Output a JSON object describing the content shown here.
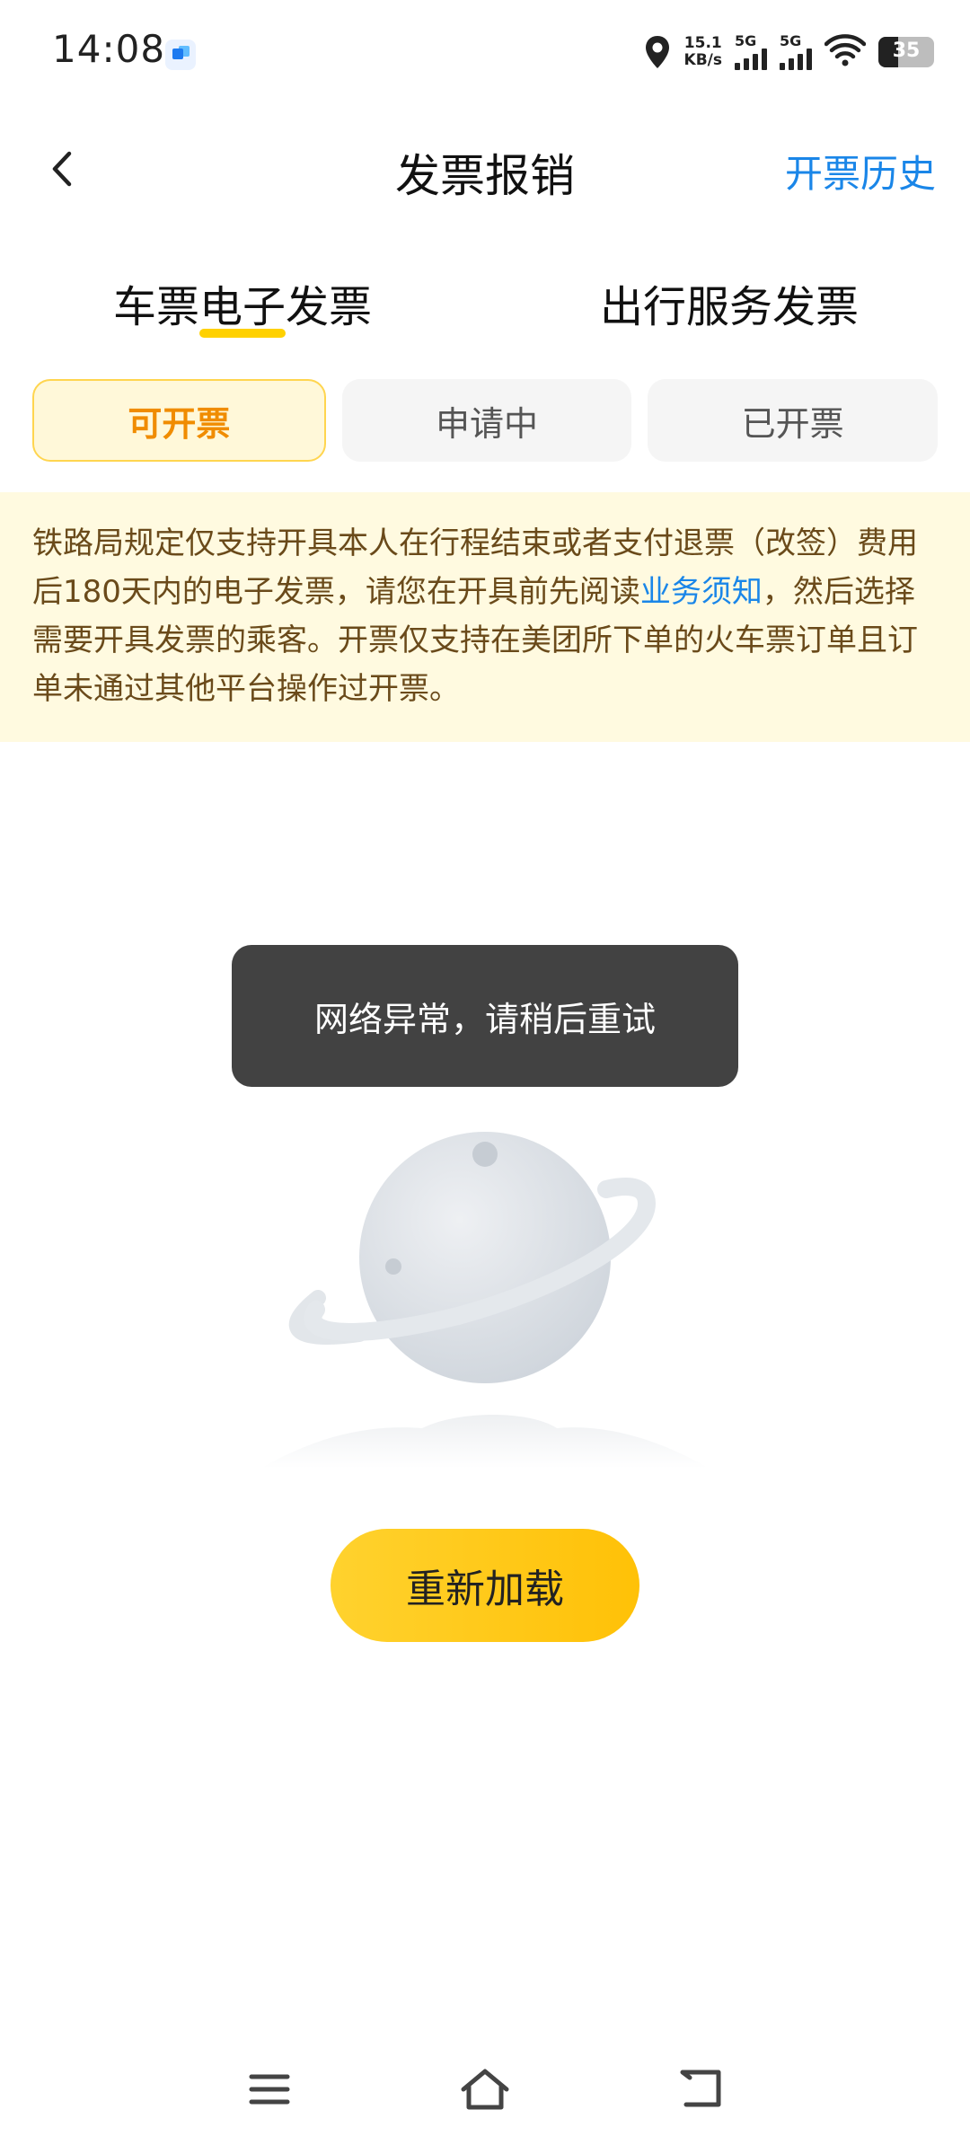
{
  "status_bar": {
    "time": "14:08",
    "net_speed_value": "15.1",
    "net_speed_unit": "KB/s",
    "sim1_label": "5G",
    "sim2_label": "5G",
    "battery_level": "35",
    "icons": [
      "app-notification-icon",
      "location-icon",
      "signal-icon",
      "wifi-icon",
      "battery-icon"
    ]
  },
  "header": {
    "back_icon": "chevron-left-icon",
    "title": "发票报销",
    "history_link": "开票历史",
    "accent_color": "#1a86e8"
  },
  "main_tabs": [
    {
      "label": "车票电子发票",
      "active": true
    },
    {
      "label": "出行服务发票",
      "active": false
    }
  ],
  "filters": [
    {
      "label": "可开票",
      "active": true
    },
    {
      "label": "申请中",
      "active": false
    },
    {
      "label": "已开票",
      "active": false
    }
  ],
  "notice": {
    "text_before": "铁路局规定仅支持开具本人在行程结束或者支付退票（改签）费用后180天内的电子发票，请您在开具前先阅读",
    "link_text": "业务须知",
    "text_after": "，然后选择需要开具发票的乘客。开票仅支持在美团所下单的火车票订单且订单未通过其他平台操作过开票。",
    "background_color": "#fffae0"
  },
  "toast": {
    "text": "网络异常，请稍后重试"
  },
  "empty_state": {
    "illustration": "planet-illustration"
  },
  "reload_button": {
    "label": "重新加载",
    "color": "#ffc107"
  },
  "nav_bar": {
    "icons": [
      "menu-icon",
      "home-icon",
      "back-icon"
    ]
  }
}
